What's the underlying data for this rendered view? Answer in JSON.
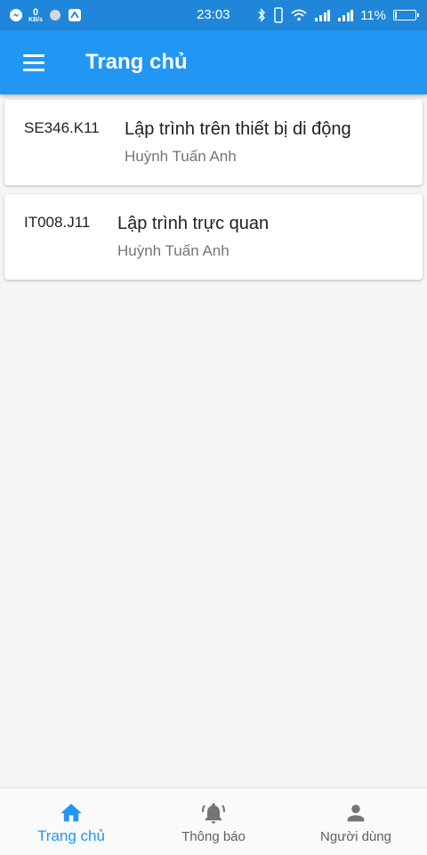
{
  "status_bar": {
    "time": "23:03",
    "speed_value": "0",
    "speed_unit": "KB/s",
    "battery_text": "11%",
    "battery_level": 0.11
  },
  "app_bar": {
    "title": "Trang chủ"
  },
  "courses": [
    {
      "code": "SE346.K11",
      "name": "Lập trình trên thiết bị di động",
      "teacher": "Huỳnh Tuấn Anh"
    },
    {
      "code": "IT008.J11",
      "name": "Lập trình trực quan",
      "teacher": "Huỳnh Tuấn Anh"
    }
  ],
  "bottom_nav": {
    "items": [
      {
        "label": "Trang chủ",
        "icon": "home-icon",
        "active": true
      },
      {
        "label": "Thông báo",
        "icon": "bell-icon",
        "active": false
      },
      {
        "label": "Người dùng",
        "icon": "person-icon",
        "active": false
      }
    ]
  },
  "colors": {
    "status_bar": "#1f86d9",
    "primary": "#2196f3",
    "inactive_nav": "#757575"
  }
}
